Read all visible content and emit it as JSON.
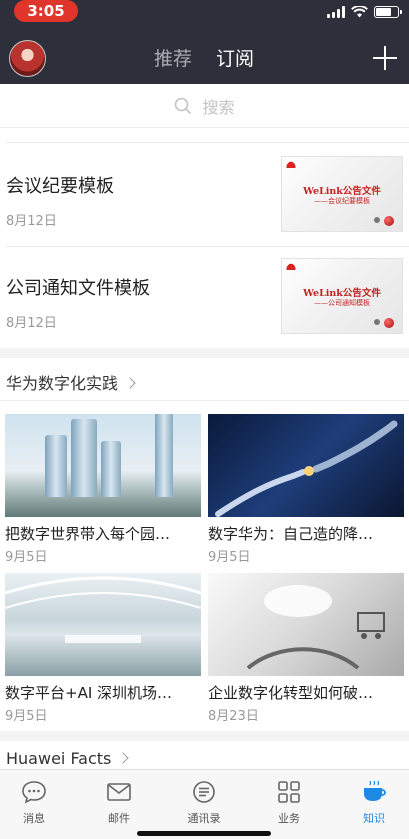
{
  "status_bar": {
    "time": "3:05",
    "battery_level": 0.7
  },
  "header": {
    "tabs": [
      {
        "label": "推荐",
        "active": false
      },
      {
        "label": "订阅",
        "active": true
      }
    ],
    "add_icon": "plus-icon"
  },
  "search": {
    "placeholder": "搜索"
  },
  "documents": [
    {
      "title": "会议纪要模板",
      "date": "8月12日",
      "thumb_title": "WeLink公告文件",
      "thumb_subtitle": "——会议纪要模板"
    },
    {
      "title": "公司通知文件模板",
      "date": "8月12日",
      "thumb_title": "WeLink公告文件",
      "thumb_subtitle": "——公司通知模板"
    }
  ],
  "section": {
    "title": "华为数字化实践"
  },
  "articles": [
    {
      "title": "把数字世界带入每个园…",
      "date": "9月5日"
    },
    {
      "title": "数字华为：自己造的降…",
      "date": "9月5日"
    },
    {
      "title": "数字平台+AI 深圳机场…",
      "date": "9月5日"
    },
    {
      "title": "企业数字化转型如何破…",
      "date": "8月23日"
    }
  ],
  "next_section": {
    "title": "Huawei Facts"
  },
  "tabbar": [
    {
      "label": "消息",
      "icon": "message-icon",
      "active": false
    },
    {
      "label": "邮件",
      "icon": "mail-icon",
      "active": false
    },
    {
      "label": "通讯录",
      "icon": "contacts-icon",
      "active": false
    },
    {
      "label": "业务",
      "icon": "apps-icon",
      "active": false
    },
    {
      "label": "知识",
      "icon": "knowledge-cup-icon",
      "active": true
    }
  ],
  "colors": {
    "header_bg": "#2d2f3a",
    "accent": "#1e88e5",
    "time_pill": "#e0352b"
  }
}
